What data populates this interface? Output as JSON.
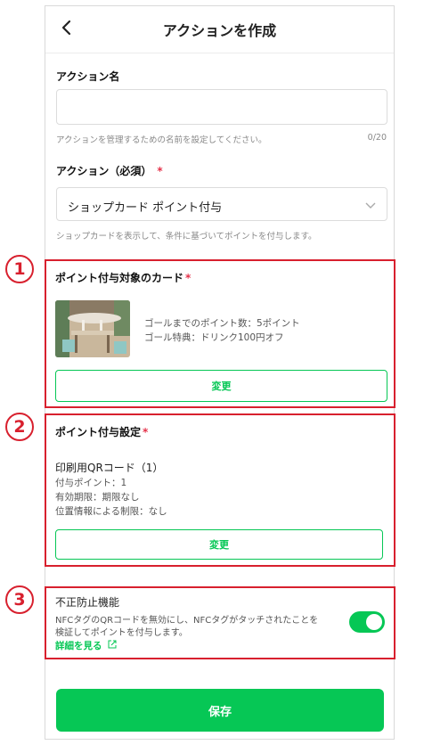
{
  "header": {
    "title": "アクションを作成",
    "back_icon": "chevron-left-icon"
  },
  "action_name": {
    "label": "アクション名",
    "value": "",
    "help": "アクションを管理するための名前を設定してください。",
    "counter": "0/20"
  },
  "action_type": {
    "label": "アクション（必須）",
    "required_mark": "*",
    "selected": "ショップカード ポイント付与",
    "help": "ショップカードを表示して、条件に基づいてポイントを付与します。"
  },
  "annotations": {
    "one": "1",
    "two": "2",
    "three": "3",
    "color": "#d8202e"
  },
  "card": {
    "label": "ポイント付与対象のカード",
    "required_mark": "*",
    "goal_points": "ゴールまでのポイント数：5ポイント",
    "goal_reward": "ゴール特典：ドリンク100円オフ",
    "change_label": "変更"
  },
  "point_settings": {
    "label": "ポイント付与設定",
    "required_mark": "*",
    "qr_title": "印刷用QRコード（1）",
    "points": "付与ポイント：1",
    "expiry": "有効期限：期限なし",
    "location": "位置情報による制限：なし",
    "change_label": "変更"
  },
  "fraud": {
    "label": "不正防止機能",
    "desc1": "NFCタグのQRコードを無効にし、NFCタグがタッチされたことを",
    "desc2": "検証してポイントを付与します。",
    "link": "詳細を見る",
    "enabled": true
  },
  "save_label": "保存",
  "colors": {
    "accent": "#06c755",
    "required": "#e5324a"
  }
}
